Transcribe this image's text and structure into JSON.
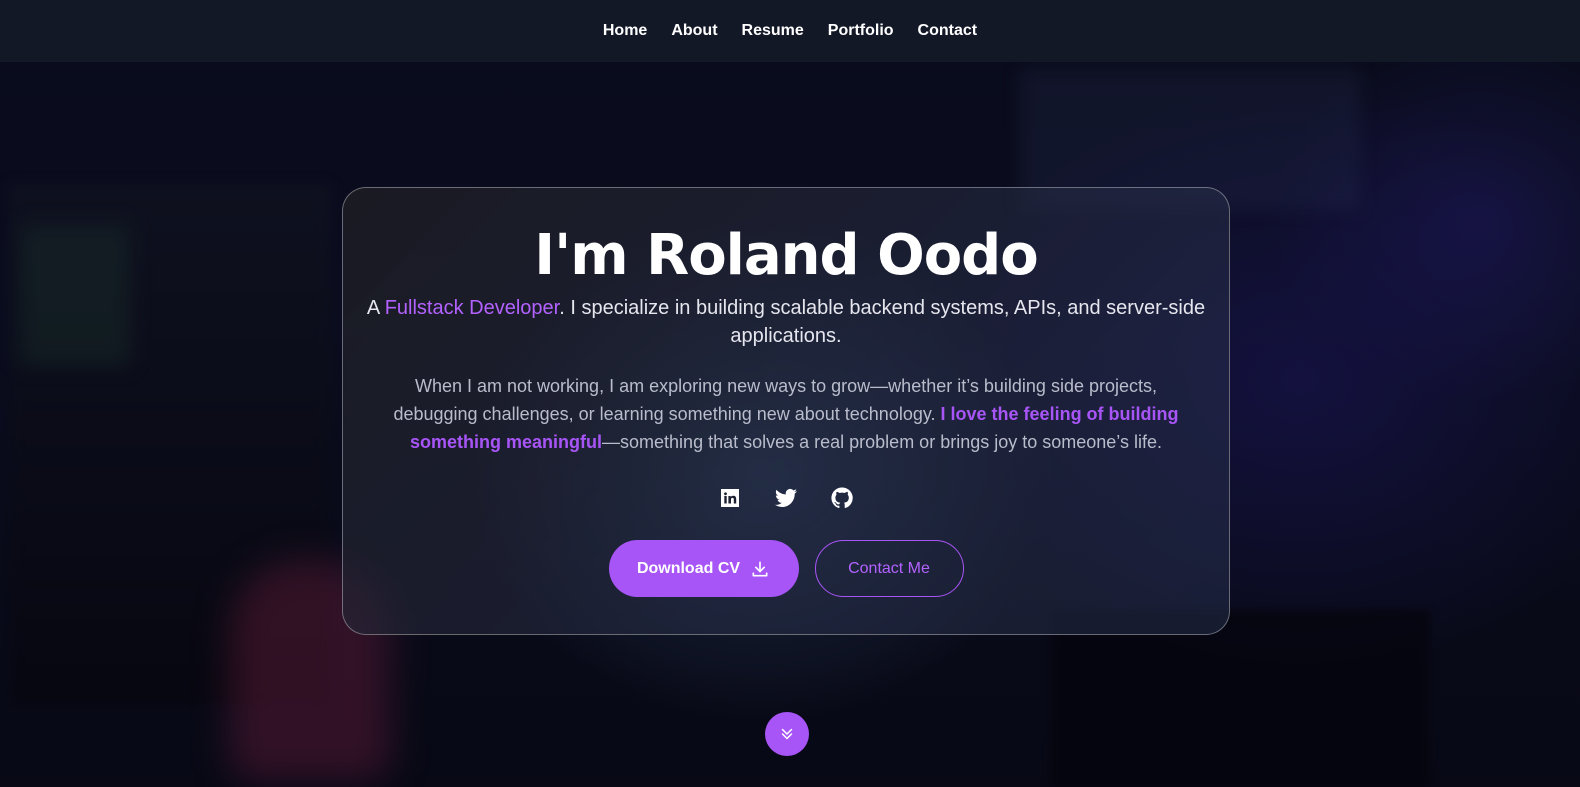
{
  "nav": {
    "items": [
      {
        "label": "Home"
      },
      {
        "label": "About"
      },
      {
        "label": "Resume"
      },
      {
        "label": "Portfolio"
      },
      {
        "label": "Contact"
      }
    ]
  },
  "hero": {
    "title": "I'm Roland Oodo",
    "subtitle": {
      "prefix": "A ",
      "role": "Fullstack Developer",
      "rest": ". I specialize in building scalable backend systems, APIs, and server-side applications."
    },
    "bio": {
      "part1": "When I am not working, I am exploring new ways to grow—whether it’s building side projects, debugging challenges, or learning something new about technology. ",
      "highlight": "I love the feeling of building something meaningful",
      "part2": "—something that solves a real problem or brings joy to someone’s life."
    },
    "socials": [
      {
        "icon": "linkedin-icon"
      },
      {
        "icon": "twitter-icon"
      },
      {
        "icon": "github-icon"
      }
    ],
    "buttons": {
      "download_cv": "Download CV",
      "contact_me": "Contact Me"
    }
  },
  "scroll": {
    "icon": "chevrons-down-icon"
  },
  "colors": {
    "accent": "#a855f7",
    "accent_text": "#b362ff",
    "navbar_bg": "#131827"
  }
}
